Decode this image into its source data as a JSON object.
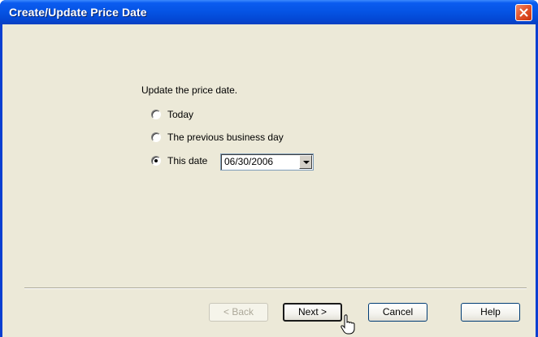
{
  "window": {
    "title": "Create/Update Price Date"
  },
  "form": {
    "prompt": "Update the price date.",
    "options": [
      {
        "label": "Today",
        "selected": false
      },
      {
        "label": "The previous business day",
        "selected": false
      },
      {
        "label": "This date",
        "selected": true
      }
    ],
    "date_value": "06/30/2006"
  },
  "buttons": {
    "back": "< Back",
    "next": "Next >",
    "cancel": "Cancel",
    "help": "Help"
  },
  "colors": {
    "title_bar": "#0553e3",
    "close_button": "#e4572e",
    "dialog_background": "#ece9d8"
  },
  "icons": {
    "close": "close-icon",
    "dropdown": "chevron-down-icon",
    "cursor": "hand-pointer-cursor"
  }
}
